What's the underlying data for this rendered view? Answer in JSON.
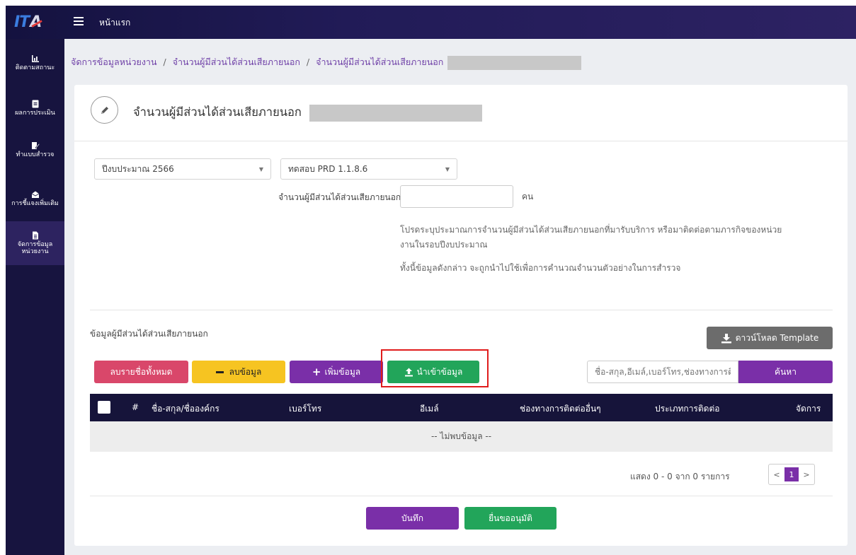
{
  "topbar": {
    "logo_text": "IT",
    "home_label": "หน้าแรก"
  },
  "sidebar": {
    "items": [
      {
        "label": "ติดตามสถานะ",
        "icon": "chart-icon"
      },
      {
        "label": "ผลการประเมิน",
        "icon": "document-icon"
      },
      {
        "label": "ทำแบบสำรวจ",
        "icon": "edit-icon"
      },
      {
        "label": "การชี้แจงเพิ่มเติม",
        "icon": "mail-icon"
      },
      {
        "label": "จัดการข้อมูล หน่วยงาน",
        "icon": "file-icon",
        "active": true
      }
    ]
  },
  "breadcrumb": {
    "item1": "จัดการข้อมูลหน่วยงาน",
    "item2": "จำนวนผู้มีส่วนได้ส่วนเสียภายนอก",
    "item3": "จำนวนผู้มีส่วนได้ส่วนเสียภายนอก",
    "sep": "/"
  },
  "card": {
    "title": "จำนวนผู้มีส่วนได้ส่วนเสียภายนอก"
  },
  "form": {
    "fiscal_year": "ปีงบประมาณ 2566",
    "test_select": "ทดสอบ PRD 1.1.8.6",
    "count_label": "จำนวนผู้มีส่วนได้ส่วนเสียภายนอก",
    "required_mark": "*",
    "count_value": "",
    "unit": "คน",
    "help1": "โปรดระบุประมาณการจำนวนผู้มีส่วนได้ส่วนเสียภายนอกที่มารับบริการ หรือมาติดต่อตามภารกิจของหน่วยงานในรอบปีงบประมาณ",
    "help2": "ทั้งนี้ข้อมูลดังกล่าว จะถูกนำไปใช้เพื่อการคำนวณจำนวนตัวอย่างในการสำรวจ"
  },
  "section": {
    "label": "ข้อมูลผู้มีส่วนได้ส่วนเสียภายนอก",
    "download_label": "ดาวน์โหลด Template",
    "delete_all_label": "ลบรายชื่อทั้งหมด",
    "delete_label": "ลบข้อมูล",
    "add_label": "เพิ่มข้อมูล",
    "import_label": "นำเข้าข้อมูล",
    "search_placeholder": "ชื่อ-สกุล,อีเมล์,เบอร์โทร,ช่องทางการติดต่ออื่นๆ",
    "search_label": "ค้นหา"
  },
  "table": {
    "columns": [
      "#",
      "ชื่อ-สกุล/ชื่อองค์กร",
      "เบอร์โทร",
      "อีเมล์",
      "ช่องทางการติดต่ออื่นๆ",
      "ประเภทการติดต่อ",
      "จัดการ"
    ],
    "empty": "-- ไม่พบข้อมูล --"
  },
  "pagination": {
    "info": "แสดง 0 - 0 จาก 0 รายการ",
    "prev": "<",
    "current": "1",
    "next": ">"
  },
  "actions": {
    "save_label": "บันทึก",
    "submit_label": "ยื่นขออนุมัติ"
  },
  "colors": {
    "primary": "#7a2fa8",
    "success": "#22a55a",
    "danger": "#d9476a",
    "warning": "#f6c421",
    "header_dark": "#16143a"
  }
}
